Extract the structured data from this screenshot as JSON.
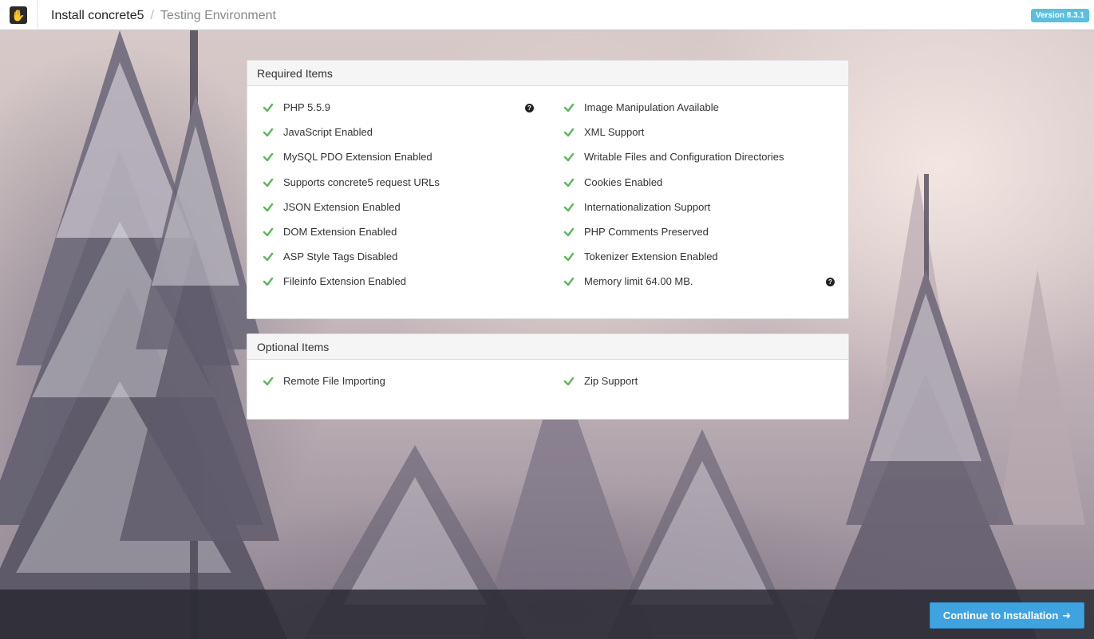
{
  "header": {
    "title": "Install concrete5",
    "subtitle": "Testing Environment",
    "version": "Version 8.3.1"
  },
  "required": {
    "heading": "Required Items",
    "left": [
      {
        "label": "PHP 5.5.9",
        "help": true
      },
      {
        "label": "JavaScript Enabled"
      },
      {
        "label": "MySQL PDO Extension Enabled"
      },
      {
        "label": "Supports concrete5 request URLs"
      },
      {
        "label": "JSON Extension Enabled"
      },
      {
        "label": "DOM Extension Enabled"
      },
      {
        "label": "ASP Style Tags Disabled"
      },
      {
        "label": "Fileinfo Extension Enabled"
      }
    ],
    "right": [
      {
        "label": "Image Manipulation Available"
      },
      {
        "label": "XML Support"
      },
      {
        "label": "Writable Files and Configuration Directories"
      },
      {
        "label": "Cookies Enabled"
      },
      {
        "label": "Internationalization Support"
      },
      {
        "label": "PHP Comments Preserved"
      },
      {
        "label": "Tokenizer Extension Enabled"
      },
      {
        "label": "Memory limit 64.00 MB.",
        "help": true
      }
    ]
  },
  "optional": {
    "heading": "Optional Items",
    "left": [
      {
        "label": "Remote File Importing"
      }
    ],
    "right": [
      {
        "label": "Zip Support"
      }
    ]
  },
  "footer": {
    "continue_label": "Continue to Installation"
  },
  "colors": {
    "check": "#5cb85c",
    "button": "#3fa3e0",
    "badge": "#5bc0de"
  },
  "icons": {
    "status": "check-icon",
    "help": "question-circle-icon",
    "logo": "concrete5-logo-icon",
    "continue": "arrow-right-icon"
  }
}
